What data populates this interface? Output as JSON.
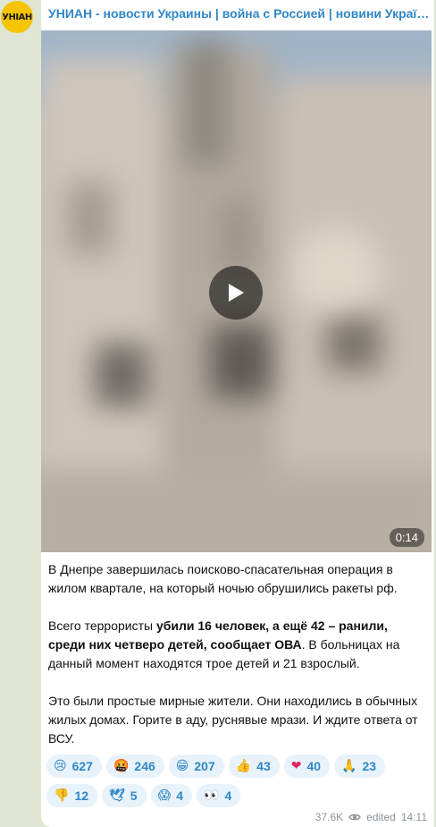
{
  "channel": {
    "avatar_text": "УНІАН",
    "name": "УНИАН - новости Украины | война с Россией | новини України..."
  },
  "video": {
    "duration": "0:14"
  },
  "message": {
    "p1": "В Днепре завершилась поисково-спасательная операция в жилом квартале, на который ночью обрушились ракеты рф.",
    "p2_a": "Всего террористы ",
    "p2_b": "убили 16 человек, а ещё 42 – ранили, среди них четверо детей, сообщает ОВА",
    "p2_c": ". В больницах на данный момент находятся трое детей и 21 взрослый.",
    "p3": "Это были простые мирные жители. Они находились в обычных жилых домах. Горите в аду, руснявые мрази. И ждите ответа от ВСУ."
  },
  "reactions": [
    {
      "emoji": "😢",
      "count": "627"
    },
    {
      "emoji": "🤬",
      "count": "246"
    },
    {
      "emoji": "😁",
      "count": "207"
    },
    {
      "emoji": "👍",
      "count": "43"
    },
    {
      "emoji": "❤",
      "count": "40"
    },
    {
      "emoji": "🙏",
      "count": "23"
    },
    {
      "emoji": "👎",
      "count": "12"
    },
    {
      "emoji": "🕊",
      "count": "5"
    },
    {
      "emoji": "😱",
      "count": "4"
    },
    {
      "emoji": "👀",
      "count": "4"
    }
  ],
  "meta": {
    "views": "37.6K",
    "edited_label": "edited",
    "time": "14:11"
  },
  "colors": {
    "accent": "#2f87c6",
    "reaction_bg": "#e8f2fa",
    "background": "#dfe7d4",
    "avatar": "#f6c400"
  }
}
